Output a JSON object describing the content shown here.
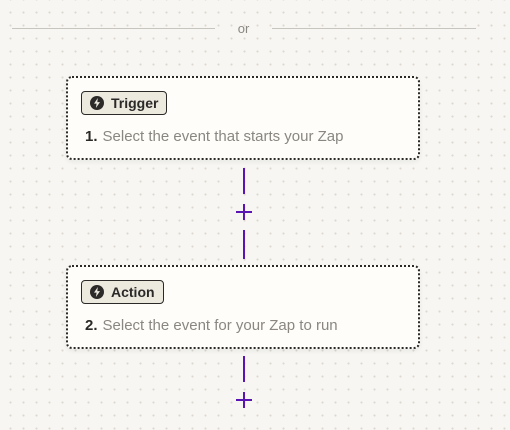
{
  "divider": {
    "text": "or"
  },
  "steps": [
    {
      "badge_label": "Trigger",
      "badge_icon": "bolt-icon",
      "number": "1.",
      "text": "Select the event that starts your Zap"
    },
    {
      "badge_label": "Action",
      "badge_icon": "bolt-icon",
      "number": "2.",
      "text": "Select the event for your Zap to run"
    }
  ],
  "add_step_icon": "plus-icon",
  "colors": {
    "background": "#f7f6f2",
    "card_background": "#fffdf9",
    "card_border": "#2b2a28",
    "badge_background": "#ece9df",
    "connector": "#5a14b3",
    "muted_text": "#8a8781"
  }
}
